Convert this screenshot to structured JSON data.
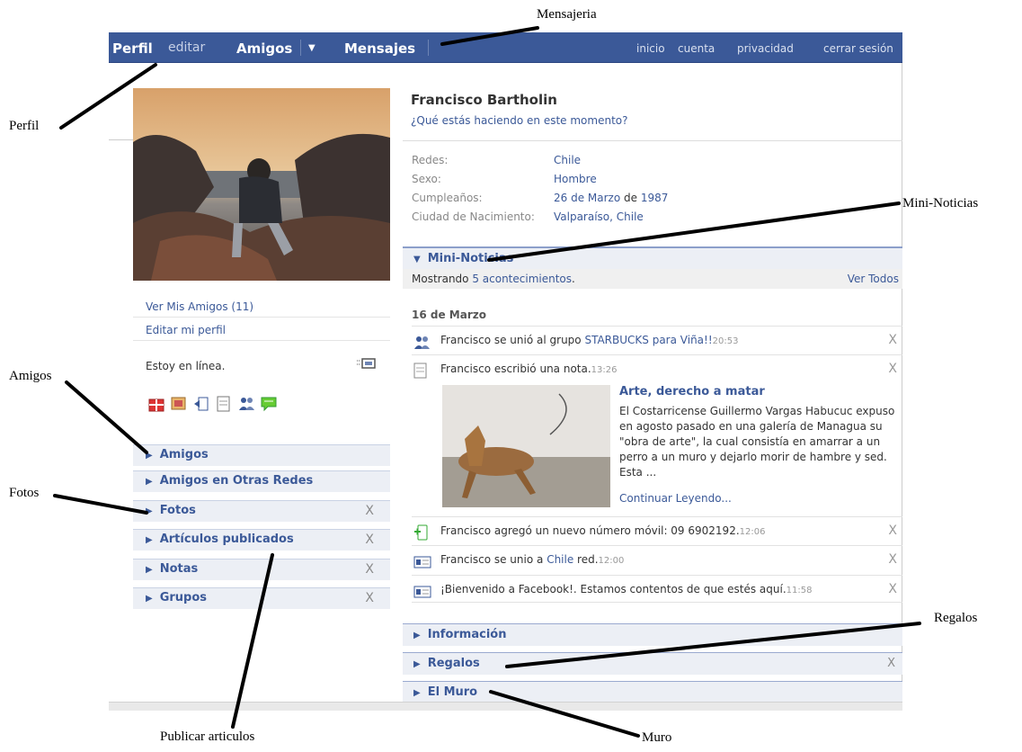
{
  "nav": {
    "perfil": "Perfil",
    "editar": "editar",
    "amigos": "Amigos",
    "amigos_caret": "▼",
    "mensajes": "Mensajes",
    "inicio": "inicio",
    "cuenta": "cuenta",
    "privacidad": "privacidad",
    "cerrar": "cerrar sesión"
  },
  "left": {
    "ver_amigos": "Ver Mis Amigos (11)",
    "editar_perfil": "Editar mi perfil",
    "online": "Estoy en línea.",
    "boxes": [
      {
        "label": "Amigos",
        "close": ""
      },
      {
        "label": "Amigos en Otras Redes",
        "close": ""
      },
      {
        "label": "Fotos",
        "close": "X"
      },
      {
        "label": "Artículos publicados",
        "close": "X"
      },
      {
        "label": "Notas",
        "close": "X"
      },
      {
        "label": "Grupos",
        "close": "X"
      }
    ]
  },
  "profile": {
    "name": "Francisco Bartholin",
    "status_prompt": "¿Qué estás haciendo en este momento?",
    "info": [
      {
        "label": "Redes:",
        "value": "Chile"
      },
      {
        "label": "Sexo:",
        "value": "Hombre"
      },
      {
        "label": "Cumpleaños:",
        "value_link": "26 de Marzo",
        "value_plain": " de ",
        "value_link2": "1987"
      },
      {
        "label": "Ciudad de Nacimiento:",
        "value": "Valparaíso, Chile"
      }
    ]
  },
  "mininews": {
    "title": "Mini-Noticias",
    "showing_prefix": "Mostrando ",
    "showing_link": "5 acontecimientos",
    "showing_suffix": ".",
    "see_all": "Ver Todos",
    "date": "16 de Marzo",
    "items": [
      {
        "pre": "Francisco se unió al grupo ",
        "link": "STARBUCKS para Viña!!",
        "post": "",
        "time": "20:53",
        "icon": "group-icon"
      },
      {
        "pre": "Francisco escribió una nota.",
        "link": "",
        "post": "",
        "time": "13:26",
        "icon": "note-icon"
      },
      {
        "pre": "Francisco agregó un nuevo número móvil: 09 6902192.",
        "link": "",
        "post": "",
        "time": "12:06",
        "icon": "mobile-icon"
      },
      {
        "pre": "Francisco se unio a ",
        "link": "Chile",
        "post": " red.",
        "time": "12:00",
        "icon": "network-icon"
      },
      {
        "pre": "¡Bienvenido a Facebook!. Estamos contentos de que estés aquí.",
        "link": "",
        "post": "",
        "time": "11:58",
        "icon": "welcome-icon"
      }
    ],
    "close": "X",
    "note": {
      "title": "Arte, derecho a matar",
      "body": "El Costarricense Guillermo Vargas Habucuc expuso en agosto pasado en una galería de Managua su \"obra de arte\", la cual consistía en amarrar a un perro a un muro y dejarlo morir de hambre y sed. Esta ...",
      "more": "Continuar Leyendo..."
    }
  },
  "sections": [
    {
      "label": "Información",
      "close": ""
    },
    {
      "label": "Regalos",
      "close": "X"
    },
    {
      "label": "El Muro",
      "close": ""
    }
  ],
  "annotations": {
    "mensajeria": "Mensajeria",
    "perfil": "Perfil",
    "mini_noticias": "Mini-Noticias",
    "amigos": "Amigos",
    "fotos": "Fotos",
    "regalos": "Regalos",
    "publicar": "Publicar articulos",
    "muro": "Muro"
  },
  "colors": {
    "brand": "#3b5998",
    "box_bg": "#eceff5"
  }
}
